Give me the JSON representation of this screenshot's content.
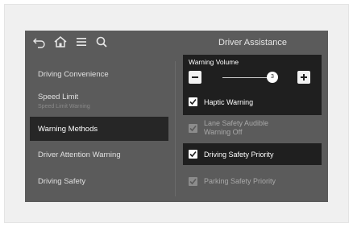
{
  "header": {
    "title": "Driver Assistance"
  },
  "toolbar": {
    "icons": [
      "back-icon",
      "home-icon",
      "menu-icon",
      "search-icon"
    ]
  },
  "menu": {
    "items": [
      {
        "label": "Driving Convenience"
      },
      {
        "label": "Speed Limit",
        "sublabel": "Speed Limit Warning"
      },
      {
        "label": "Warning Methods",
        "selected": true
      },
      {
        "label": "Driver Attention Warning"
      },
      {
        "label": "Driving Safety"
      }
    ]
  },
  "settings": {
    "warning_volume": {
      "label": "Warning Volume",
      "value": "3",
      "level_fraction": 0.72
    },
    "haptic_warning": {
      "label": "Haptic Warning",
      "checked": true,
      "enabled": true
    },
    "lane_safety": {
      "label_line1": "Lane Safety Audible",
      "label_line2": "Warning Off",
      "checked": true,
      "enabled": false
    },
    "driving_safety_priority": {
      "label": "Driving Safety Priority",
      "checked": true,
      "enabled": true
    },
    "parking_safety_priority": {
      "label": "Parking Safety Priority",
      "checked": true,
      "enabled": false
    }
  },
  "colors": {
    "screen_bg": "#5b5b5b",
    "highlight_bg": "#1f1f1f",
    "text": "#ffffff",
    "disabled_text": "#a8a8a8"
  }
}
